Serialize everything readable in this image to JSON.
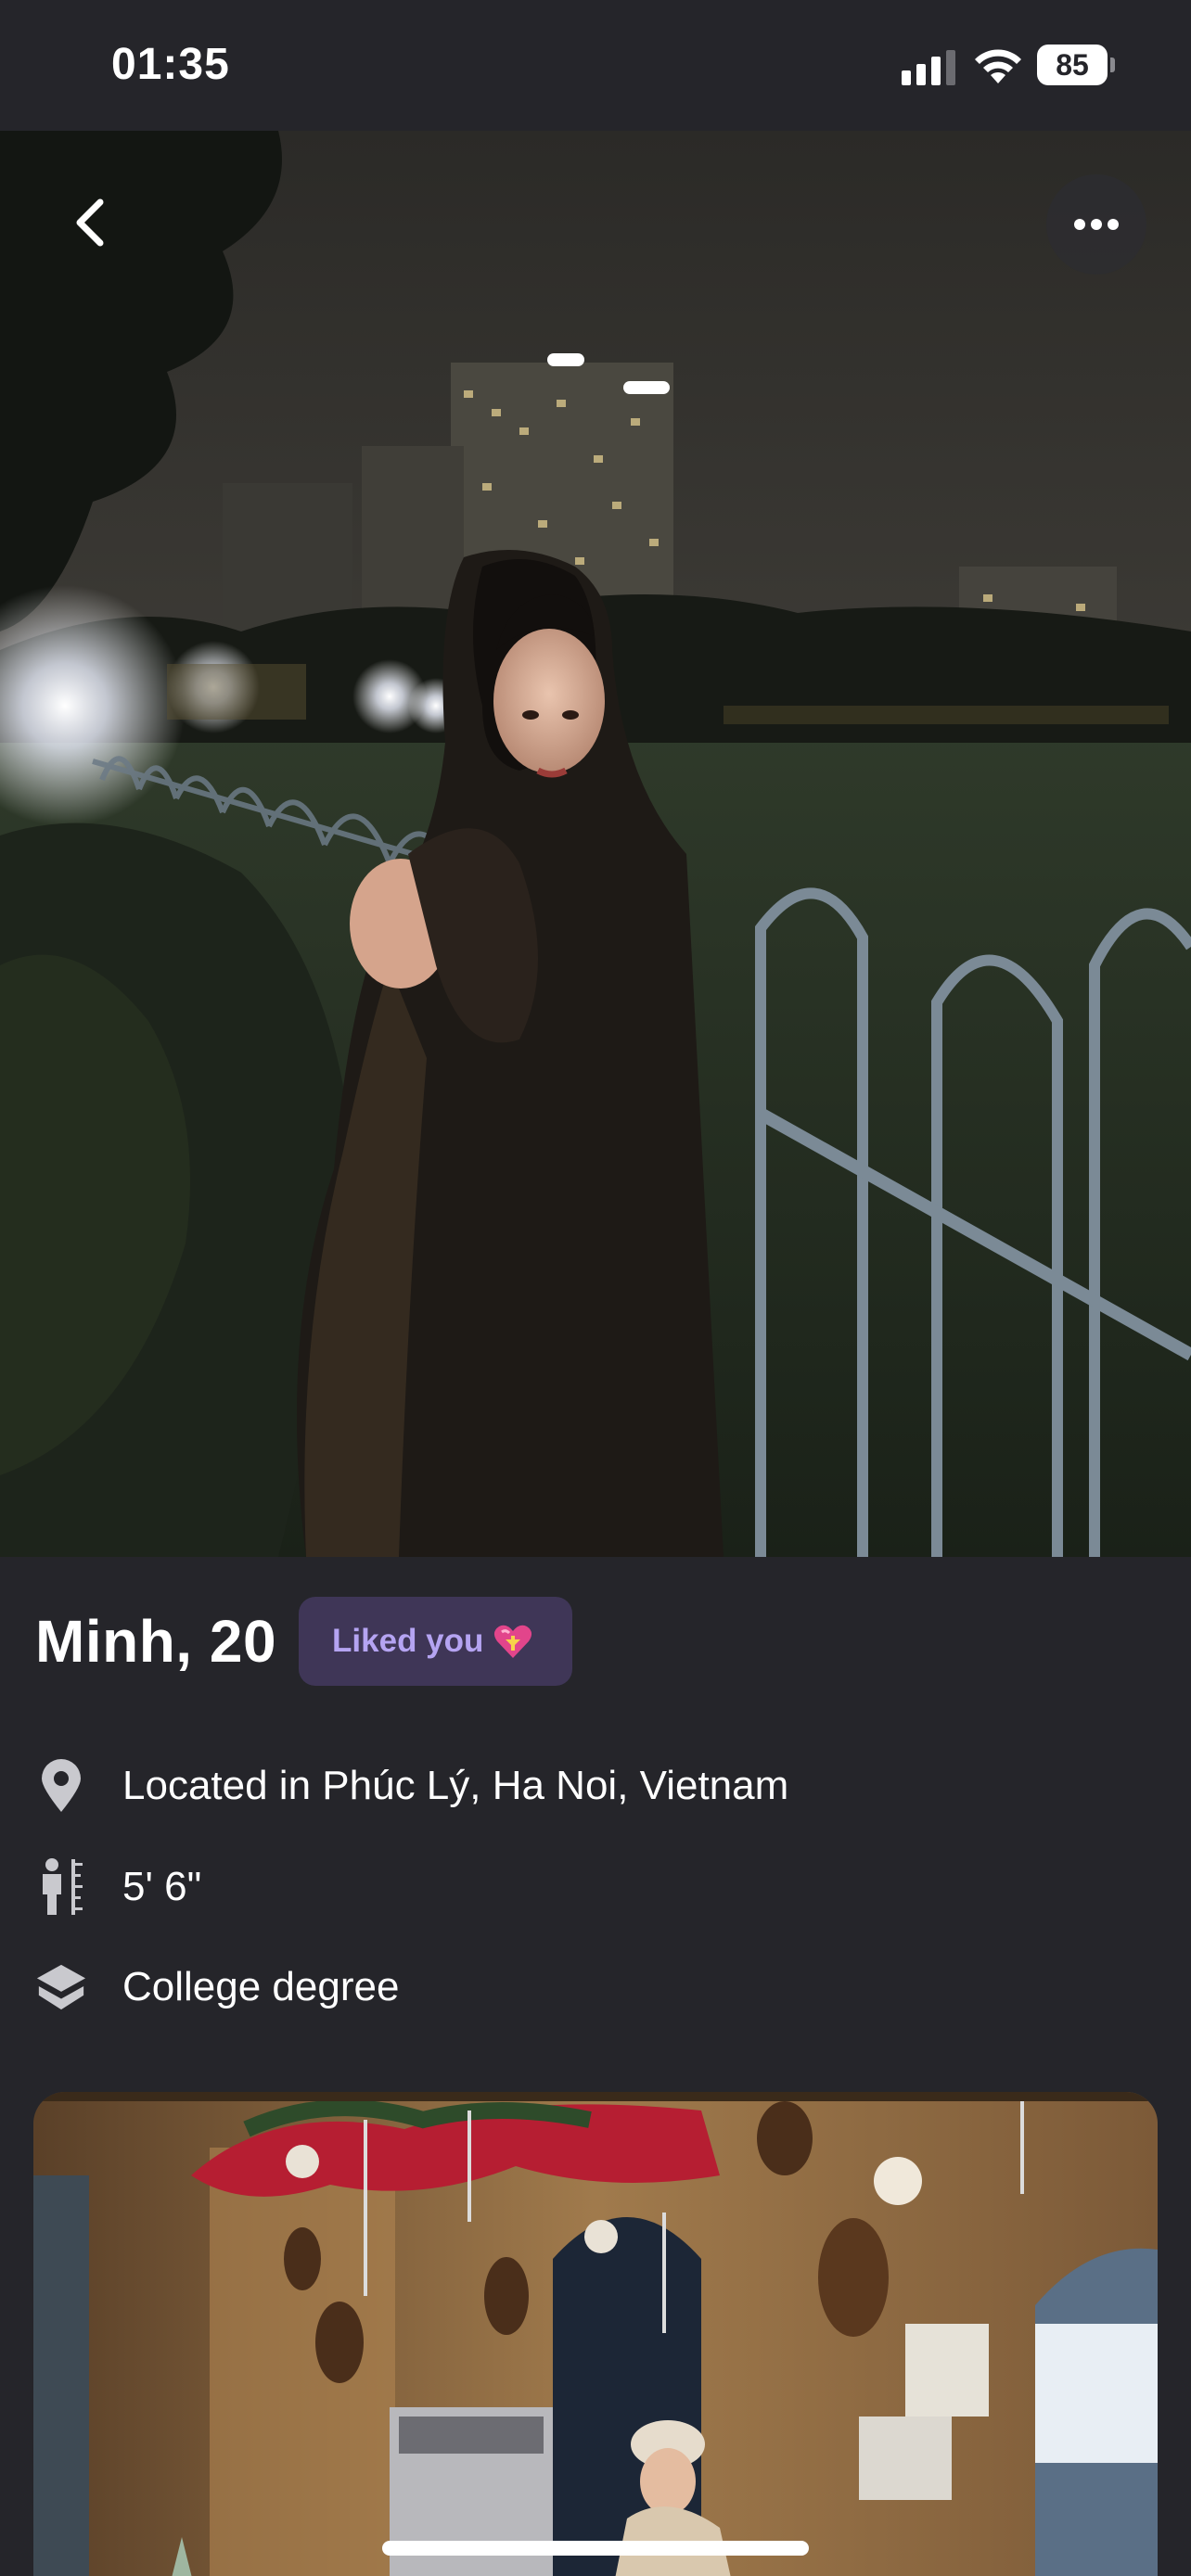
{
  "status_bar": {
    "time": "01:35",
    "battery": "85",
    "signal_icon": "cellular-signal-icon",
    "wifi_icon": "wifi-icon"
  },
  "navigation": {
    "back_icon": "chevron-left-icon",
    "more_icon": "ellipsis-icon"
  },
  "profile": {
    "name_age": "Minh, 20",
    "liked_badge": "Liked you",
    "liked_badge_icon": "heart-with-ribbon-icon",
    "details": [
      {
        "icon": "location-pin-icon",
        "text": "Located in Phúc Lý, Ha Noi, Vietnam"
      },
      {
        "icon": "height-icon",
        "text": "5' 6\""
      },
      {
        "icon": "graduation-cap-icon",
        "text": "College degree"
      }
    ]
  },
  "photos": [
    {
      "description": "night-portrait-photo"
    },
    {
      "description": "cafe-christmas-decor-photo"
    }
  ],
  "colors": {
    "background": "#25252a",
    "badge_background": "#3f3657",
    "badge_text": "#b5a4f2",
    "icon_gray": "#c9c9ce"
  }
}
